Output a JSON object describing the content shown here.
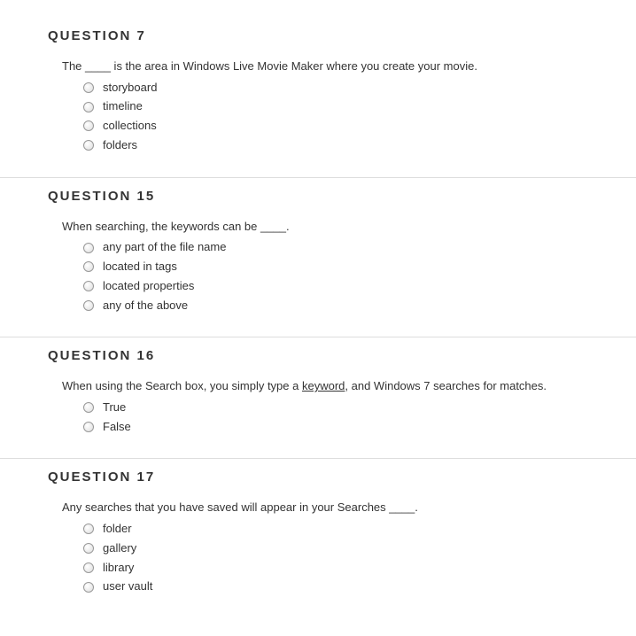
{
  "questions": [
    {
      "header": "QUESTION 7",
      "text_pre": "The ",
      "blank": "____",
      "text_post": " is the area in Windows Live Movie Maker where you create your movie.",
      "options": [
        "storyboard",
        "timeline",
        "collections",
        "folders"
      ]
    },
    {
      "header": "QUESTION 15",
      "text_pre": "When searching, the keywords can be ",
      "blank": "____",
      "text_post": ".",
      "options": [
        "any part of the file name",
        "located in tags",
        "located properties",
        "any of the above"
      ]
    },
    {
      "header": "QUESTION 16",
      "text_pre": "When using the Search box, you simply type a ",
      "keyword_underlined": "keyword",
      "text_post": ", and Windows 7 searches for matches.",
      "options": [
        "True",
        "False"
      ]
    },
    {
      "header": "QUESTION 17",
      "text_pre": "Any searches that you have saved will appear in your Searches ",
      "blank": "____",
      "text_post": ".",
      "options": [
        "folder",
        "gallery",
        "library",
        "user vault"
      ]
    }
  ]
}
